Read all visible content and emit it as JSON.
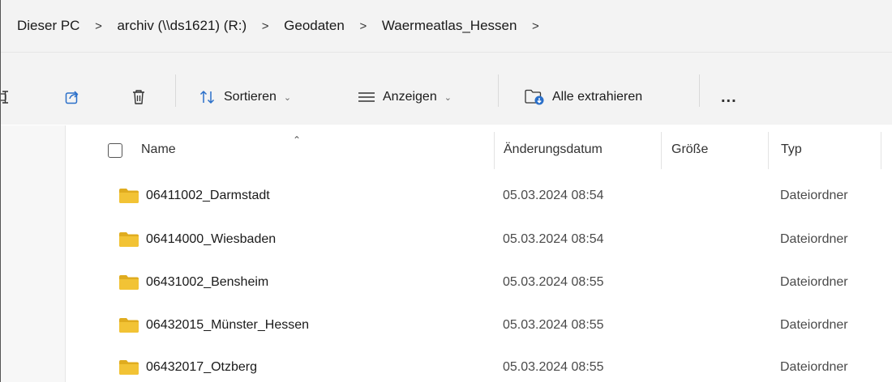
{
  "breadcrumb": {
    "items": [
      "Dieser PC",
      "archiv (\\\\ds1621) (R:)",
      "Geodaten",
      "Waermeatlas_Hessen"
    ],
    "separator": ">"
  },
  "toolbar": {
    "sort_label": "Sortieren",
    "view_label": "Anzeigen",
    "extract_label": "Alle extrahieren",
    "more_label": "..."
  },
  "columns": {
    "name": "Name",
    "modified": "Änderungsdatum",
    "size": "Größe",
    "type": "Typ"
  },
  "rows": [
    {
      "name": "06411002_Darmstadt",
      "modified": "05.03.2024 08:54",
      "type": "Dateiordner"
    },
    {
      "name": "06414000_Wiesbaden",
      "modified": "05.03.2024 08:54",
      "type": "Dateiordner"
    },
    {
      "name": "06431002_Bensheim",
      "modified": "05.03.2024 08:55",
      "type": "Dateiordner"
    },
    {
      "name": "06432015_Münster_Hessen",
      "modified": "05.03.2024 08:55",
      "type": "Dateiordner"
    },
    {
      "name": "06432017_Otzberg",
      "modified": "05.03.2024 08:55",
      "type": "Dateiordner"
    }
  ],
  "icons": {
    "folder": "folder-icon",
    "share": "share-icon",
    "delete": "trash-icon",
    "sort": "sort-icon",
    "view": "view-lines-icon",
    "extract": "zip-extract-icon",
    "more": "more-icon"
  },
  "colors": {
    "folder": "#f2c335",
    "folder_dark": "#e0ac1f",
    "accent": "#0a64c8"
  }
}
